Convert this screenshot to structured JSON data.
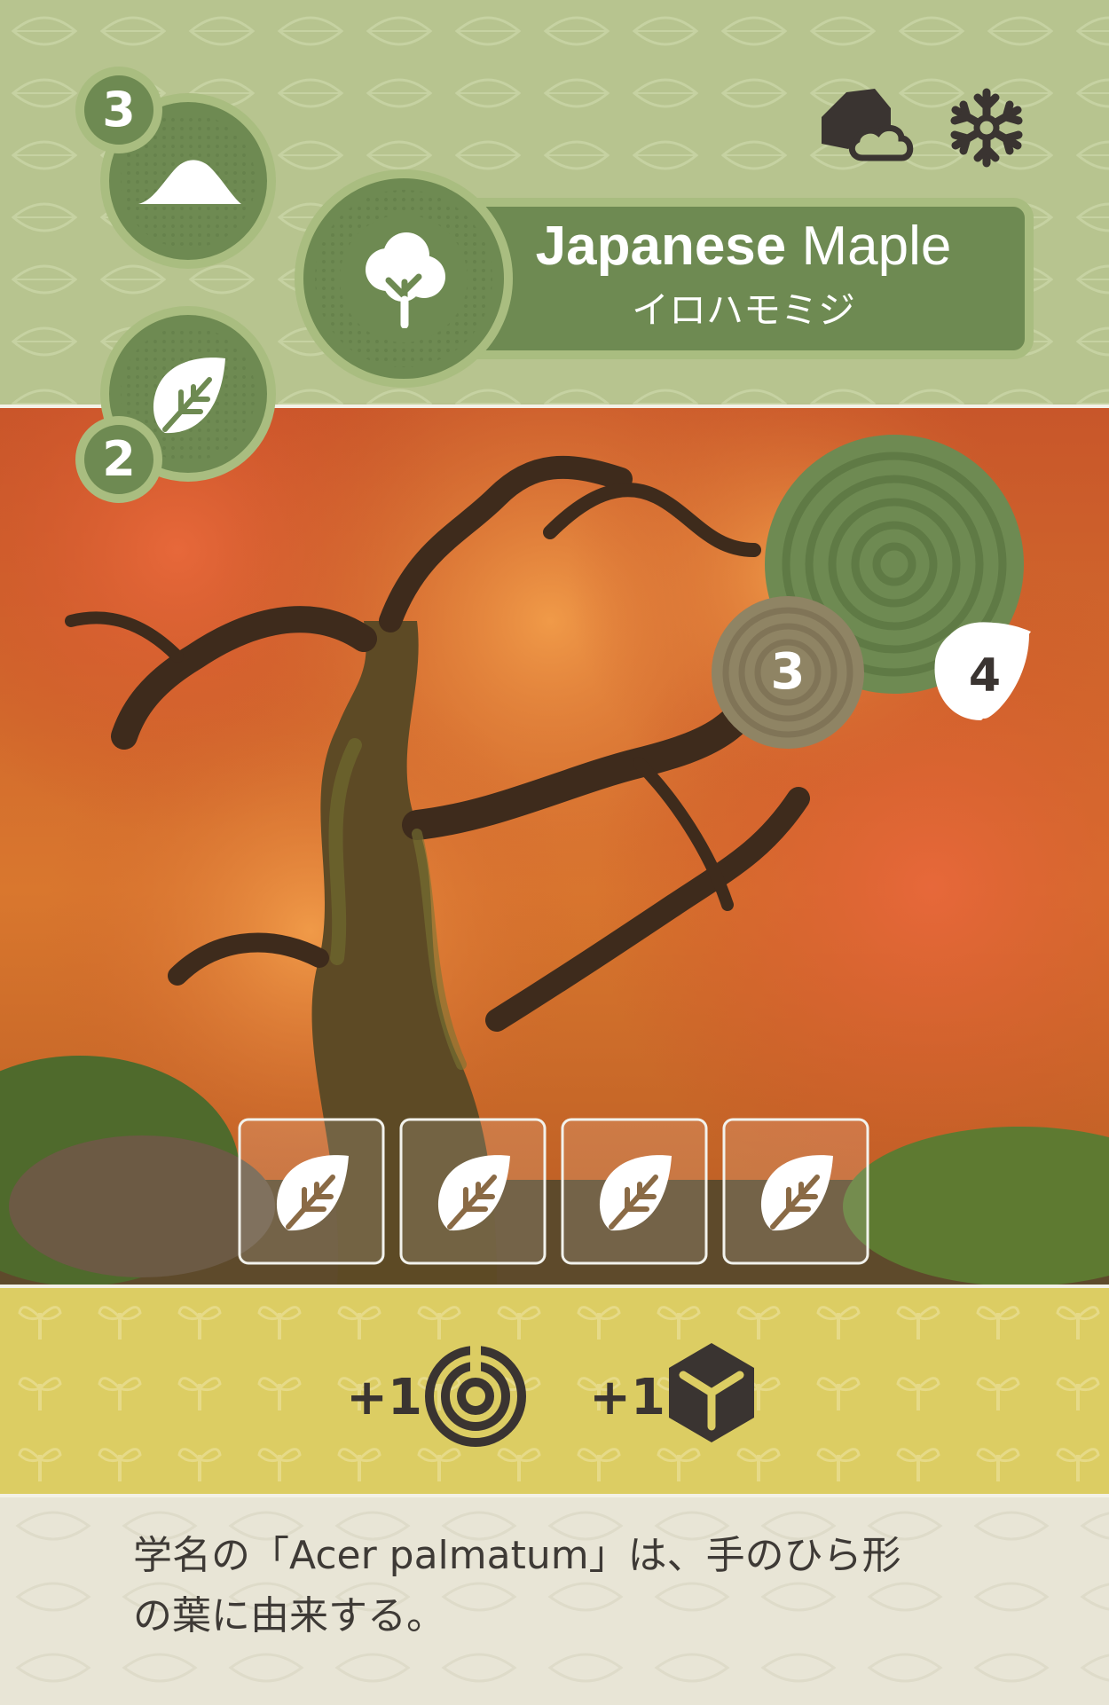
{
  "card": {
    "name_bold": "Japanese",
    "name_regular": "Maple",
    "name_jp": "イロハモミジ",
    "cost_value": "3",
    "cost_icon": "mountain-icon",
    "leaf_value": "2",
    "leaf_icon": "leaf-icon",
    "habitat_icons": [
      "rock-cloud-icon",
      "snowflake-icon"
    ],
    "type_icon": "tree-icon",
    "photo_subject": "japanese-maple-autumn-photo",
    "ring_value": "3",
    "leaf_points": "4",
    "leaf_slots": [
      "leaf-icon",
      "leaf-icon",
      "leaf-icon",
      "leaf-icon"
    ],
    "rewards": [
      {
        "label": "+1",
        "icon": "tree-rings-icon"
      },
      {
        "label": "+1",
        "icon": "cube-icon"
      }
    ],
    "flavor_line1": "学名の「Acer palmatum」は、手のひら形",
    "flavor_line2": "の葉に由来する。",
    "colors": {
      "header_bg": "#b7c48f",
      "badge_green": "#6e8a52",
      "badge_border": "#a9bd80",
      "ring_brown": "#8f8464",
      "reward_bg": "#dccd63",
      "footer_bg": "#e8e5d6",
      "icon_dark": "#3a3431"
    }
  }
}
